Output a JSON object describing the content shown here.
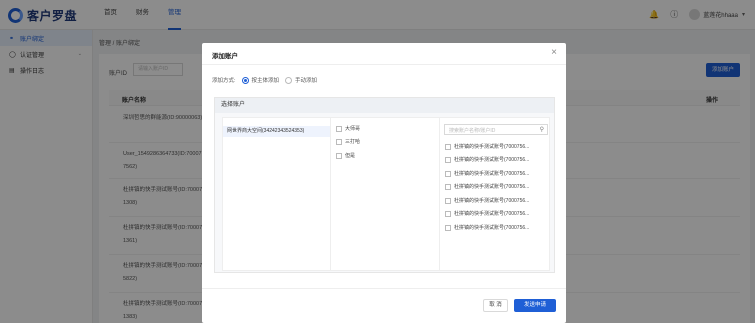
{
  "app": {
    "name": "客户罗盘"
  },
  "nav": {
    "items": [
      "首页",
      "财务",
      "管理"
    ],
    "active_index": 2
  },
  "header": {
    "username": "蓝莲花hhaaa"
  },
  "sidebar": {
    "items": [
      {
        "label": "账户绑定",
        "icon": "link-icon",
        "active": true
      },
      {
        "label": "认证管理",
        "icon": "shield-icon",
        "expandable": true
      },
      {
        "label": "操作日志",
        "icon": "log-icon"
      }
    ]
  },
  "main": {
    "breadcrumb": "管理 / 账户绑定",
    "filter": {
      "label": "账户ID",
      "placeholder": "请输入账户ID"
    },
    "add_button": "添加账户",
    "table": {
      "col_name": "账户名称",
      "col_op": "操作",
      "rows": [
        "深圳哲思的群能源(ID:90000063)",
        "User_1549286364733(ID:700077562)",
        "杜拼镇的快手测试账号(ID:700071308)",
        "杜拼镇的快手测试账号(ID:700071361)",
        "杜拼镇的快手测试账号(ID:700075822)",
        "杜拼镇的快手测试账号(ID:700071383)"
      ]
    }
  },
  "modal": {
    "title": "添加账户",
    "close": "×",
    "method_label": "添加方式:",
    "method_options": [
      "按主体添加",
      "手动添加"
    ],
    "method_selected": 0,
    "select_title": "选择账户",
    "subjects": [
      "网世界商大空间(34242343524353)"
    ],
    "groups": [
      "大师哥",
      "三打哈",
      "但是"
    ],
    "search_placeholder": "搜索账户名称/账户ID",
    "accounts": [
      "杜拼镇的快手测试账号(7000756...",
      "杜拼镇的快手测试账号(7000756...",
      "杜拼镇的快手测试账号(7000756...",
      "杜拼镇的快手测试账号(7000756...",
      "杜拼镇的快手测试账号(7000756...",
      "杜拼镇的快手测试账号(7000756...",
      "杜拼镇的快手测试账号(7000756..."
    ],
    "cancel": "取 消",
    "submit": "发送申请"
  },
  "colors": {
    "primary": "#1f5fd6",
    "overlay": "rgba(0,0,0,0.45)"
  }
}
